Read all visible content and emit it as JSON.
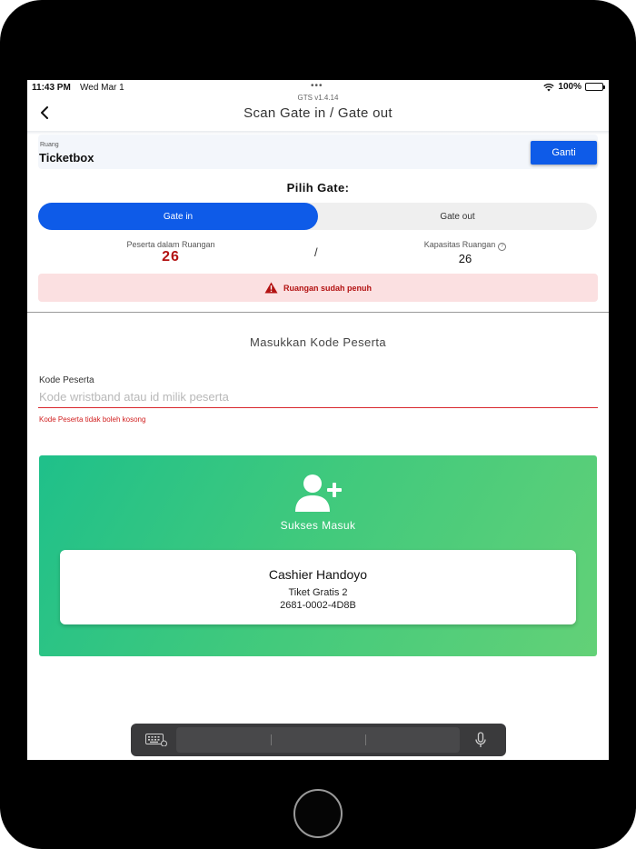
{
  "status_bar": {
    "time": "11:43 PM",
    "date": "Wed Mar 1",
    "battery": "100%"
  },
  "header": {
    "version": "GTS v1.4.14",
    "title": "Scan Gate in / Gate out"
  },
  "room": {
    "label": "Ruang",
    "name": "Ticketbox",
    "change_button": "Ganti"
  },
  "gate": {
    "heading": "Pilih Gate:",
    "options": [
      "Gate in",
      "Gate out"
    ],
    "selected": "Gate in"
  },
  "stats": {
    "participants_label": "Peserta dalam Ruangan",
    "participants_value": "26",
    "separator": "/",
    "capacity_label": "Kapasitas Ruangan",
    "capacity_value": "26"
  },
  "alert": {
    "message": "Ruangan sudah penuh"
  },
  "entry": {
    "heading": "Masukkan Kode Peserta",
    "field_label": "Kode Peserta",
    "placeholder": "Kode wristband atau id milik peserta",
    "value": "",
    "error": "Kode Peserta tidak boleh kosong"
  },
  "result": {
    "title": "Sukses Masuk",
    "holder_name": "Cashier Handoyo",
    "ticket_type": "Tiket Gratis 2",
    "ticket_code": "2681-0002-4D8B"
  },
  "colors": {
    "primary": "#0e5be8",
    "danger": "#b31212",
    "alert_bg": "#fbe0e1",
    "success_start": "#1fc08a",
    "success_end": "#63d177"
  },
  "icons": {
    "back": "chevron-left-icon",
    "info": "info-icon",
    "warning": "warning-icon",
    "success": "add-user-icon",
    "keyboard": "keyboard-icon",
    "mic": "mic-icon"
  }
}
